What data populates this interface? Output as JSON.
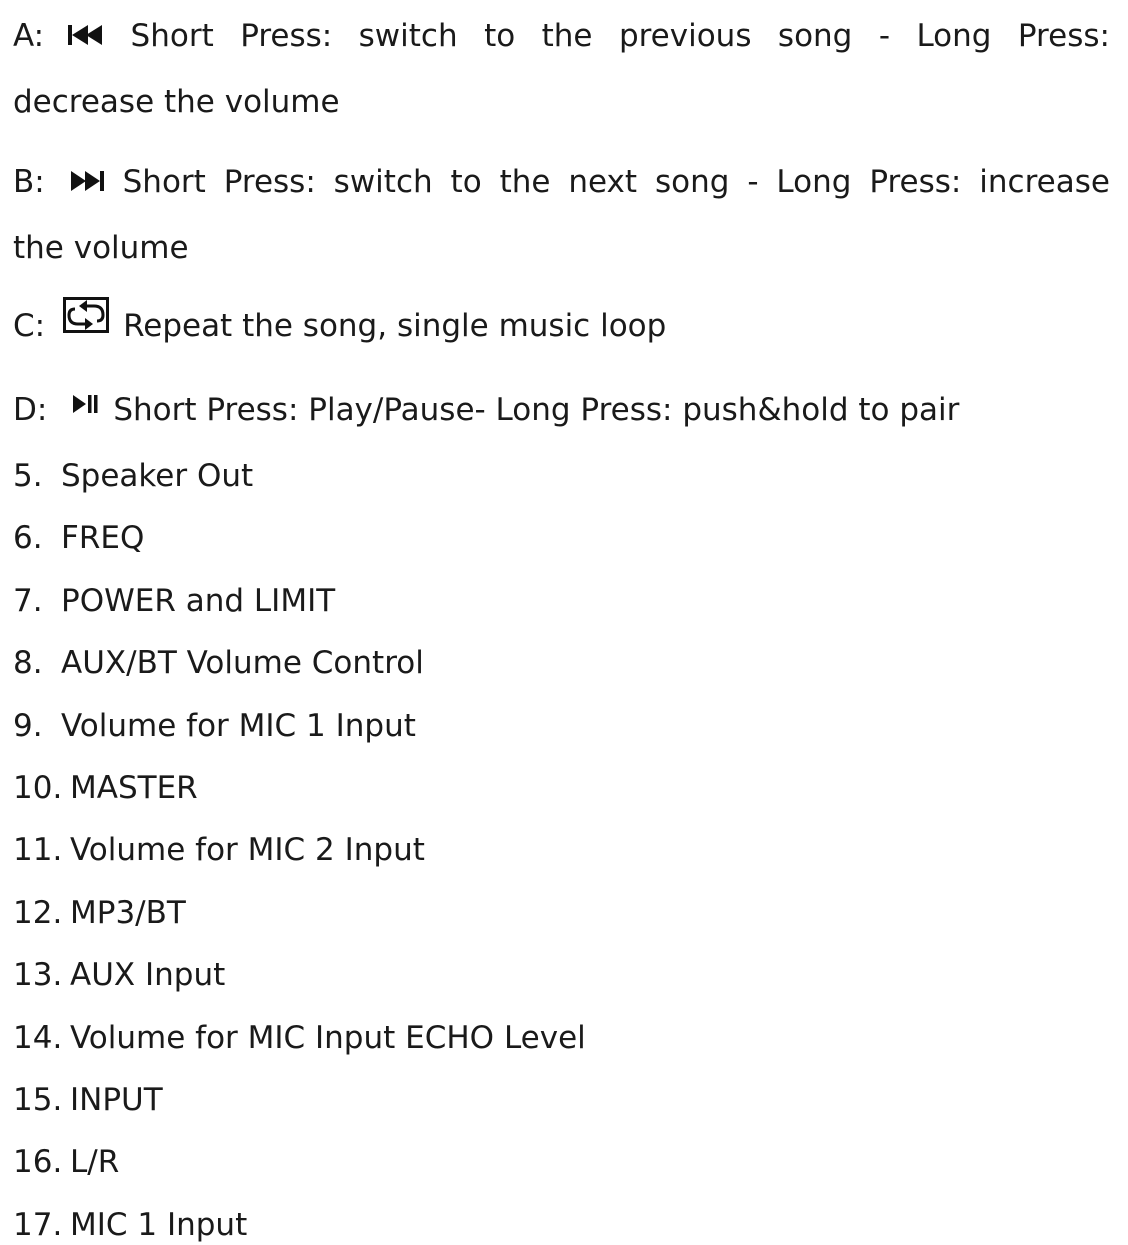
{
  "controls": {
    "a": {
      "letter": "A:",
      "icon": "previous-track-icon",
      "line1_words": [
        "Short",
        "Press:",
        "switch",
        "to",
        "the",
        "previous",
        "song",
        "-",
        "Long",
        "Press:"
      ],
      "line2": "decrease the volume"
    },
    "b": {
      "letter": "B:",
      "icon": "next-track-icon",
      "line1_words": [
        "Short",
        "Press:",
        "switch",
        "to",
        "the",
        "next",
        "song",
        "-",
        "Long",
        "Press:",
        "increase"
      ],
      "line2": "the volume"
    },
    "c": {
      "letter": "C:",
      "icon": "repeat-loop-icon",
      "text": "Repeat the song, single music loop"
    },
    "d": {
      "letter": "D:",
      "icon": "play-pause-icon",
      "text": "Short Press: Play/Pause- Long Press: push&hold to pair"
    }
  },
  "items": [
    {
      "num": "5.",
      "text": "Speaker Out"
    },
    {
      "num": "6.",
      "text": "FREQ"
    },
    {
      "num": "7.",
      "text": "POWER and LIMIT"
    },
    {
      "num": "8.",
      "text": "AUX/BT Volume Control"
    },
    {
      "num": "9.",
      "text": "Volume for MIC 1 Input"
    },
    {
      "num": "10.",
      "text": "MASTER"
    },
    {
      "num": "11.",
      "text": "Volume for MIC 2 Input"
    },
    {
      "num": "12.",
      "text": "MP3/BT"
    },
    {
      "num": "13.",
      "text": "AUX Input"
    },
    {
      "num": "14.",
      "text": "Volume for MIC Input ECHO Level"
    },
    {
      "num": "15.",
      "text": "INPUT"
    },
    {
      "num": "16.",
      "text": "L/R"
    },
    {
      "num": "17.",
      "text": "MIC 1 Input"
    }
  ]
}
